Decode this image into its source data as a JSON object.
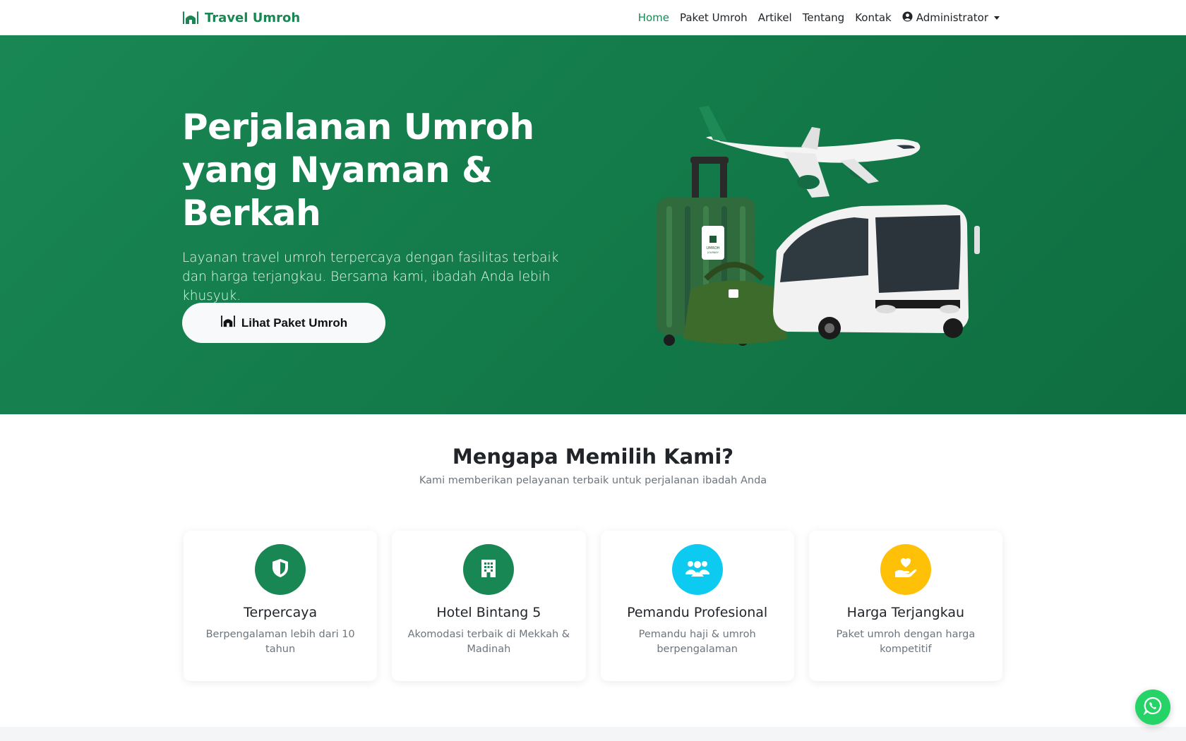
{
  "brand": {
    "name": "Travel Umroh",
    "icon": "kaaba-mosque-icon"
  },
  "nav": {
    "items": [
      {
        "label": "Home",
        "active": true
      },
      {
        "label": "Paket Umroh",
        "active": false
      },
      {
        "label": "Artikel",
        "active": false
      },
      {
        "label": "Tentang",
        "active": false
      },
      {
        "label": "Kontak",
        "active": false
      }
    ],
    "user": {
      "label": "Administrator",
      "icon": "user-circle-icon"
    }
  },
  "hero": {
    "title": "Perjalanan Umroh yang Nyaman & Berkah",
    "subtitle": "Layanan travel umroh terpercaya dengan fasilitas terbaik dan harga terjangkau. Bersama kami, ibadah Anda lebih khusyuk.",
    "button_label": "Lihat Paket Umroh",
    "art": {
      "tag_text_1": "UMROH",
      "tag_text_2": "JOURNEY"
    }
  },
  "features": {
    "title": "Mengapa Memilih Kami?",
    "subtitle": "Kami memberikan pelayanan terbaik untuk perjalanan ibadah Anda",
    "items": [
      {
        "title": "Terpercaya",
        "text": "Berpengalaman lebih dari 10 tahun",
        "icon": "shield-icon",
        "color": "#198754"
      },
      {
        "title": "Hotel Bintang 5",
        "text": "Akomodasi terbaik di Mekkah & Madinah",
        "icon": "hotel-icon",
        "color": "#198754"
      },
      {
        "title": "Pemandu Profesional",
        "text": "Pemandu haji & umroh berpengalaman",
        "icon": "users-icon",
        "color": "#0dcaf0"
      },
      {
        "title": "Harga Terjangkau",
        "text": "Paket umroh dengan harga kompetitif",
        "icon": "hand-heart-icon",
        "color": "#ffc107"
      }
    ]
  },
  "whatsapp": {
    "icon": "whatsapp-icon",
    "color": "#25d366"
  },
  "colors": {
    "primary": "#198754",
    "hero_bg": "#198754",
    "text": "#212529",
    "muted": "#6c757d"
  }
}
